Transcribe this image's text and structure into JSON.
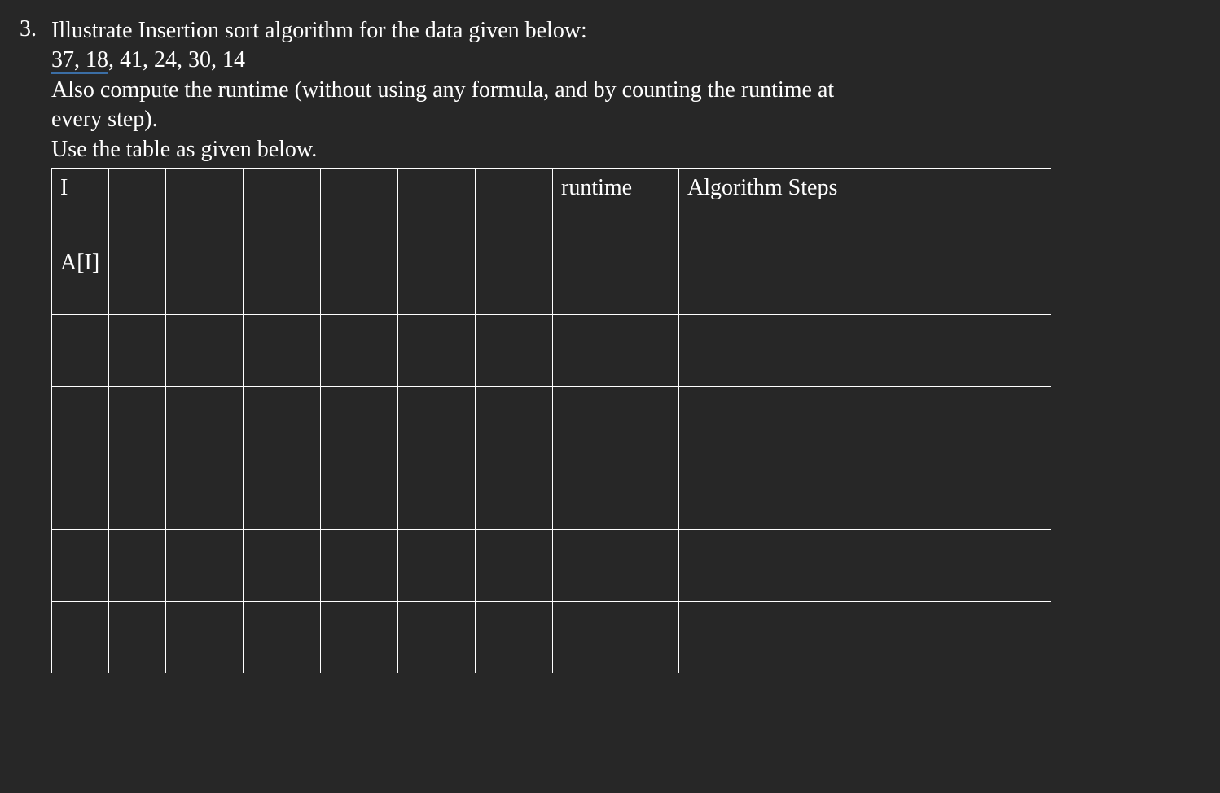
{
  "question": {
    "number": "3.",
    "line1": "Illustrate Insertion sort algorithm for the data given below:",
    "data_underlined": "37,  18",
    "data_rest": ",   41,   24,   30,  14",
    "line3": "Also compute the runtime (without using any formula, and by counting the runtime at",
    "line4": "every step).",
    "line5": "Use the table as given below."
  },
  "table": {
    "headers": {
      "col1": "I",
      "col8": "runtime",
      "col9": "Algorithm Steps"
    },
    "row2_col1": "A[I]"
  }
}
